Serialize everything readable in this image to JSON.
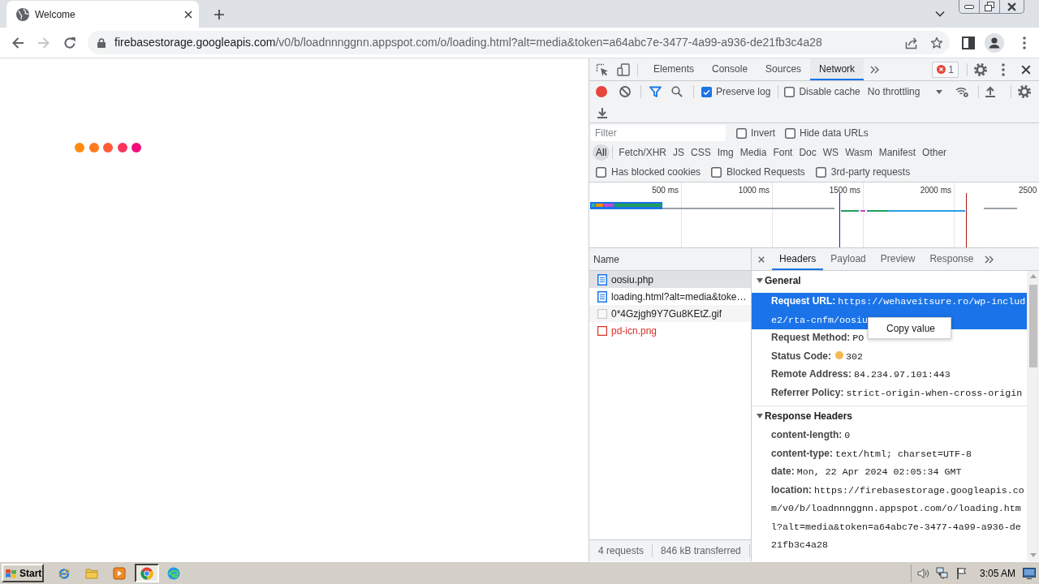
{
  "browser": {
    "tabs": [
      {
        "title": "Welcome",
        "selected": true
      }
    ],
    "url": "firebasestorage.googleapis.com/v0/b/loadnnnggnn.appspot.com/o/loading.html?alt=media&token=a64abc7e-3477-4a99-a936-de21fb3c4a28"
  },
  "page": {
    "loader_dots": [
      {
        "color": "#ff8c0f"
      },
      {
        "color": "#ff7a1e"
      },
      {
        "color": "#ff5a38"
      },
      {
        "color": "#f9345e"
      },
      {
        "color": "#f00f7c"
      }
    ]
  },
  "devtools": {
    "panel_tabs": [
      {
        "label": "Elements",
        "selected": false
      },
      {
        "label": "Console",
        "selected": false
      },
      {
        "label": "Sources",
        "selected": false
      },
      {
        "label": "Network",
        "selected": true
      }
    ],
    "error_count": "1",
    "toolbar": {
      "recording": true,
      "options": [
        {
          "label": "Preserve log",
          "checked": true
        },
        {
          "label": "Disable cache",
          "checked": false
        }
      ],
      "throttling": "No throttling"
    },
    "filter": {
      "placeholder": "Filter",
      "options": [
        {
          "label": "Invert",
          "checked": false
        },
        {
          "label": "Hide data URLs",
          "checked": false
        }
      ]
    },
    "type_filters": [
      {
        "label": "All",
        "selected": true
      },
      {
        "label": "Fetch/XHR",
        "selected": false
      },
      {
        "label": "JS",
        "selected": false
      },
      {
        "label": "CSS",
        "selected": false
      },
      {
        "label": "Img",
        "selected": false
      },
      {
        "label": "Media",
        "selected": false
      },
      {
        "label": "Font",
        "selected": false
      },
      {
        "label": "Doc",
        "selected": false
      },
      {
        "label": "WS",
        "selected": false
      },
      {
        "label": "Wasm",
        "selected": false
      },
      {
        "label": "Manifest",
        "selected": false
      },
      {
        "label": "Other",
        "selected": false
      }
    ],
    "more_filters": [
      {
        "label": "Has blocked cookies",
        "checked": false
      },
      {
        "label": "Blocked Requests",
        "checked": false
      },
      {
        "label": "3rd-party requests",
        "checked": false
      }
    ],
    "overview": {
      "ticks": [
        "500 ms",
        "1000 ms",
        "1500 ms",
        "2000 ms",
        "2500"
      ]
    },
    "requests": {
      "column": "Name",
      "rows": [
        {
          "name": "oosiu.php",
          "kind": "document",
          "selected": true,
          "failed": false
        },
        {
          "name": "loading.html?alt=media&toke…",
          "kind": "document",
          "selected": false,
          "failed": false
        },
        {
          "name": "0*4Gzjgh9Y7Gu8KEtZ.gif",
          "kind": "image",
          "selected": false,
          "failed": false
        },
        {
          "name": "pd-icn.png",
          "kind": "image",
          "selected": false,
          "failed": true
        }
      ],
      "summary": [
        "4 requests",
        "846 kB transferred"
      ]
    },
    "details": {
      "tabs": [
        {
          "label": "Headers",
          "selected": true
        },
        {
          "label": "Payload",
          "selected": false
        },
        {
          "label": "Preview",
          "selected": false
        },
        {
          "label": "Response",
          "selected": false
        }
      ],
      "sections": [
        {
          "title": "General",
          "expanded": true,
          "rows": [
            {
              "label": "Request URL:",
              "value": "https://wehaveitsure.ro/wp-include2/rta-cnfm/oosiu",
              "selected": true
            },
            {
              "label": "Request Method:",
              "value": "PO",
              "selected": false
            },
            {
              "label": "Status Code:",
              "value": "302",
              "color": "#f3b94d",
              "selected": false
            },
            {
              "label": "Remote Address:",
              "value": "84.234.97.101:443",
              "selected": false
            },
            {
              "label": "Referrer Policy:",
              "value": "strict-origin-when-cross-origin",
              "selected": false
            }
          ]
        },
        {
          "title": "Response Headers",
          "expanded": true,
          "rows": [
            {
              "label": "content-length:",
              "value": "0",
              "selected": false
            },
            {
              "label": "content-type:",
              "value": "text/html; charset=UTF-8",
              "selected": false
            },
            {
              "label": "date:",
              "value": "Mon, 22 Apr 2024 02:05:34 GMT",
              "selected": false
            },
            {
              "label": "location:",
              "value": "https://firebasestorage.googleapis.com/v0/b/loadnnnggnn.appspot.com/o/loading.html?alt=media&token=a64abc7e-3477-4a99-a936-de21fb3c4a28",
              "selected": false
            }
          ]
        }
      ]
    },
    "context_menu": {
      "items": [
        "Copy value"
      ]
    }
  },
  "taskbar": {
    "start": "Start",
    "clock": "3:05 AM"
  }
}
